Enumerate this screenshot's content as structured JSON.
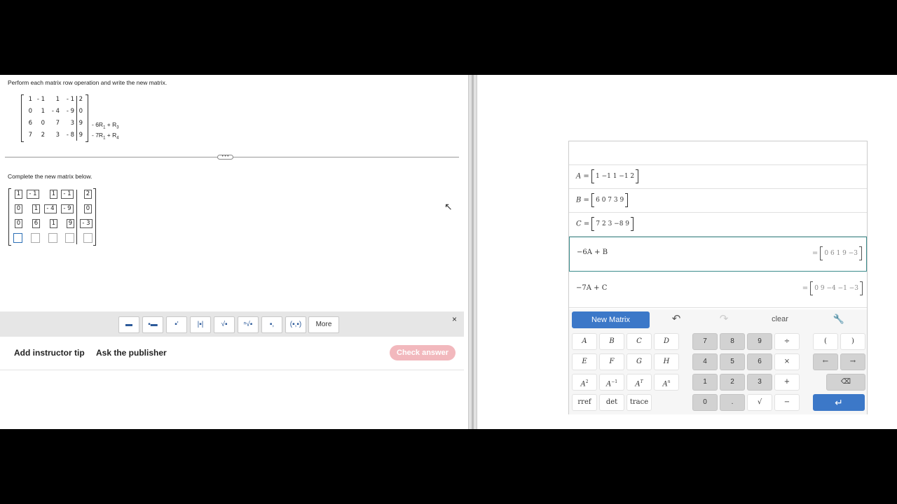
{
  "question": {
    "instruction": "Perform each matrix row operation and write the new matrix.",
    "matrix_rows": [
      [
        "1",
        "- 1",
        "1",
        "- 1",
        "2"
      ],
      [
        "0",
        "1",
        "- 4",
        "- 9",
        "0"
      ],
      [
        "6",
        "0",
        "7",
        "3",
        "9"
      ],
      [
        "7",
        "2",
        "3",
        "- 8",
        "9"
      ]
    ],
    "operations": {
      "op3": {
        "coef": "- 6R",
        "sub1": "1",
        "mid": " + R",
        "sub2": "3"
      },
      "op4": {
        "coef": "- 7R",
        "sub1": "1",
        "mid": " + R",
        "sub2": "4"
      }
    },
    "complete_label": "Complete the new matrix below.",
    "answer_rows": [
      [
        "1",
        "- 1",
        "1",
        "- 1",
        "2"
      ],
      [
        "0",
        "1",
        "- 4",
        "- 9",
        "0"
      ],
      [
        "0",
        "6",
        "1",
        "9",
        "- 3"
      ],
      [
        "",
        "",
        "",
        "",
        ""
      ]
    ]
  },
  "toolbar": {
    "buttons": [
      "fraction-icon",
      "mixed-number-icon",
      "exponent-icon",
      "absolute-value-icon",
      "square-root-icon",
      "nth-root-icon",
      "subscript-icon",
      "ordered-pair-icon"
    ],
    "button_glyphs": [
      "▬",
      "▪▬",
      "▪'",
      "|▪|",
      "√▪",
      "ⁿ√▪",
      "▪,",
      "(▪,▪)"
    ],
    "more_label": "More",
    "close_glyph": "×"
  },
  "actions": {
    "instructor_tip": "Add instructor tip",
    "ask_publisher": "Ask the publisher",
    "check_answer": "Check answer"
  },
  "calculator": {
    "rows": [
      {
        "name": "A",
        "values": "1  −1  1  −1  2"
      },
      {
        "name": "B",
        "values": "6  0  7  3  9"
      },
      {
        "name": "C",
        "values": "7  2  3  −8  9"
      }
    ],
    "expr1": {
      "text": "−6A + B",
      "result": "0  6  1  9  −3"
    },
    "expr2": {
      "text": "−7A + C",
      "result": "0  9  −4  −1  −3"
    },
    "keys": {
      "new_matrix": "New Matrix",
      "clear": "clear",
      "letters": [
        "A",
        "B",
        "C",
        "D",
        "E",
        "F",
        "G",
        "H"
      ],
      "rref": "rref",
      "det": "det",
      "trace": "trace",
      "digits": [
        "7",
        "8",
        "9",
        "4",
        "5",
        "6",
        "1",
        "2",
        "3",
        "0",
        "."
      ],
      "ops": [
        "÷",
        "×",
        "+",
        "−"
      ],
      "sqrt": "√",
      "lparen": "(",
      "rparen": ")",
      "left_arrow": "←",
      "right_arrow": "→"
    }
  }
}
